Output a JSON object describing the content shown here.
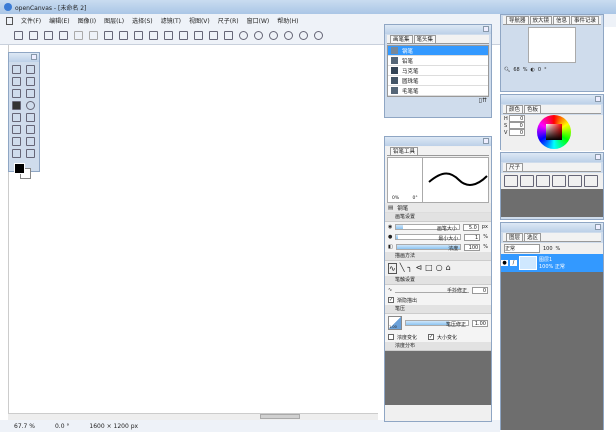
{
  "title": "openCanvas - [未命名 2]",
  "menu": [
    "文件(F)",
    "编辑(E)",
    "图像(I)",
    "图层(L)",
    "选择(S)",
    "滤镜(T)",
    "视图(V)",
    "尺子(R)",
    "窗口(W)",
    "帮助(H)"
  ],
  "status": {
    "zoom": "67.7 %",
    "angle": "0.0 °",
    "size": "1600 × 1200 px"
  },
  "brush_panel": {
    "tabs": [
      "画笔集",
      "笔头集"
    ],
    "items": [
      "钢笔",
      "铅笔",
      "马克笔",
      "圆珠笔",
      "毛笔笔"
    ],
    "selected": 0
  },
  "pen_panel": {
    "tab": "铅笔工具",
    "preview_labels": [
      "0%",
      "0°"
    ],
    "tool_name": "钢笔",
    "section_brush": "画笔设置",
    "brush_size_label": "画笔大小",
    "brush_size": "5.0",
    "brush_size_unit": "px",
    "min_size_label": "最小大小",
    "min_size": "1",
    "min_size_unit": "%",
    "density_label": "浓度",
    "density": "100",
    "density_unit": "%",
    "density_fraction": 1.0,
    "section_draw": "描画方法",
    "section_correction": "笔触设置",
    "hand_correction_label": "手抖修正",
    "hand_correction": "0",
    "fade_label": "渐隐描出",
    "fade_checked": true,
    "section_pressure": "笔压",
    "pressure_label": "笔压修正",
    "pressure": "1.00",
    "pressure_curve_value": "1.00",
    "opacity_label": "浓度变化",
    "opacity_checked": false,
    "size_change_label": "大小变化",
    "size_change_checked": true,
    "section_texture": "浓度分布"
  },
  "navigator": {
    "tabs": [
      "导航器",
      "放大镜",
      "信息",
      "事件记录"
    ],
    "zoom": "68",
    "zoom_unit": "%",
    "angle": "0",
    "angle_unit": "°"
  },
  "color": {
    "tabs": [
      "颜色",
      "色板"
    ],
    "h_label": "H",
    "h": "0",
    "s_label": "S",
    "s": "0",
    "v_label": "V",
    "v": "0",
    "foreground": "#000000",
    "background": "#ffffff"
  },
  "ruler": {
    "tab": "尺子"
  },
  "layers": {
    "tabs": [
      "图层",
      "选区"
    ],
    "blend": "正常",
    "opacity": "100",
    "opacity_unit": "%",
    "layer_name": "图层1",
    "layer_info": "100% 正常"
  }
}
